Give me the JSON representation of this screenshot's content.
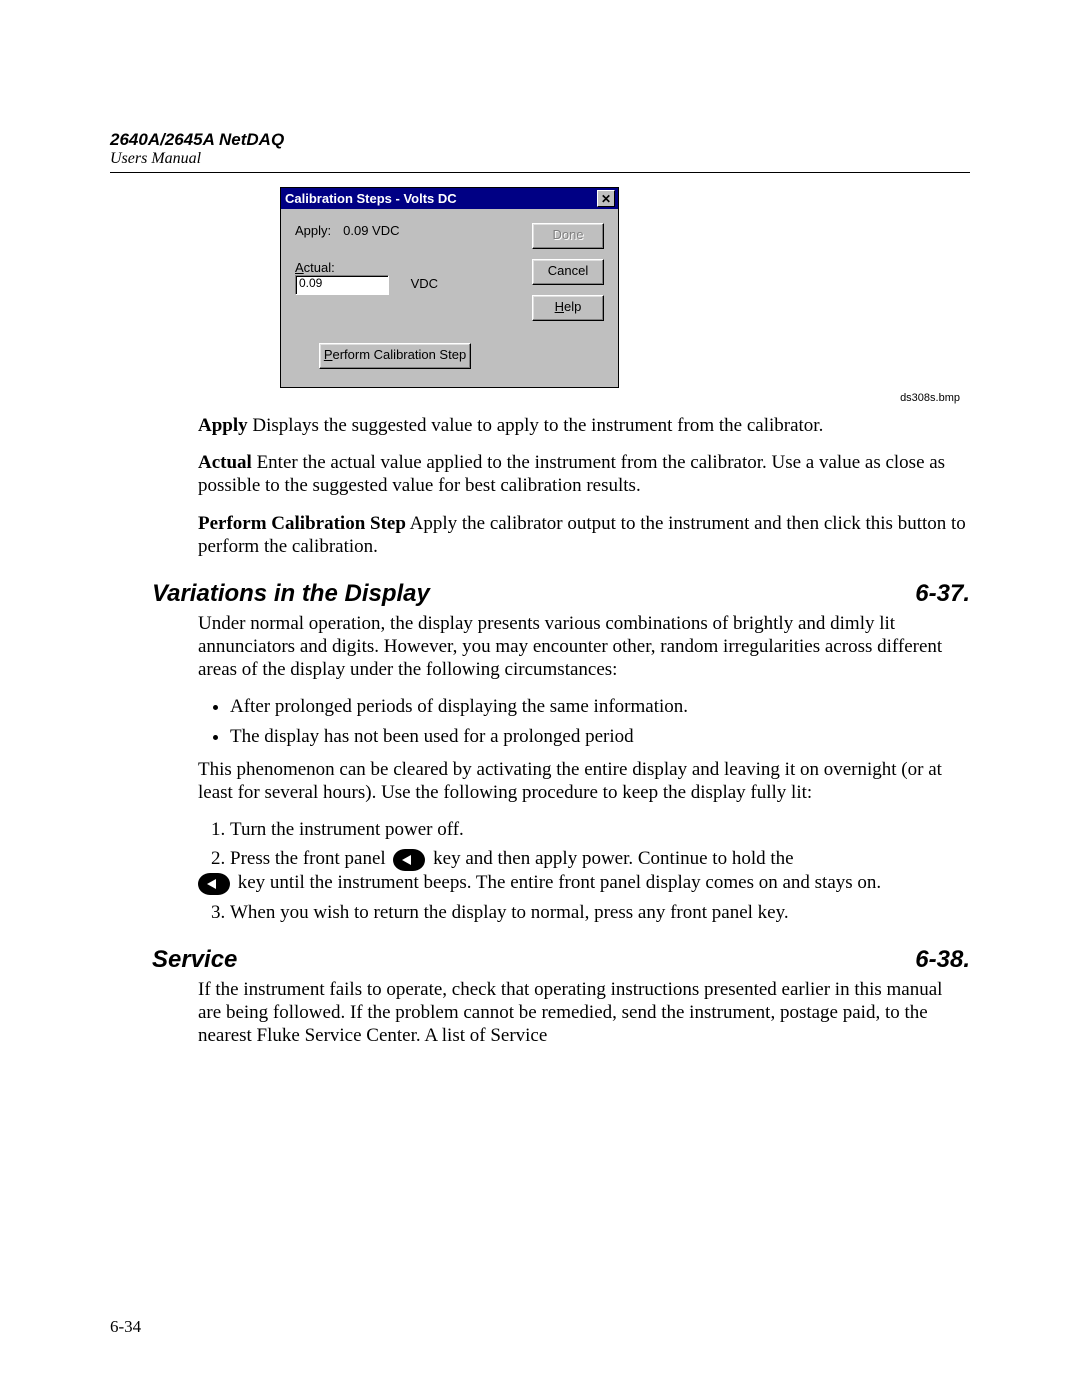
{
  "header": {
    "model": "2640A/2645A NetDAQ",
    "sub": "Users Manual"
  },
  "dialog": {
    "title": "Calibration Steps - Volts DC",
    "applyLabel": "Apply:",
    "applyValue": "0.09 VDC",
    "actualLabel": "Actual:",
    "actualValue": "0.09",
    "actualUnit": "VDC",
    "buttons": {
      "done": "Done",
      "cancel": "Cancel",
      "help": "Help",
      "perform": "Perform Calibration Step"
    }
  },
  "caption": "ds308s.bmp",
  "defs": {
    "apply": {
      "term": "Apply",
      "text": " Displays the suggested value to apply to the instrument from the calibrator."
    },
    "actual": {
      "term": "Actual",
      "text": " Enter the actual value applied to the instrument from the calibrator. Use a value as close as possible to the suggested value for best calibration results."
    },
    "perform": {
      "term": "Perform Calibration Step",
      "text": " Apply the calibrator output to the instrument and then click this button to perform the calibration."
    }
  },
  "sec1": {
    "title": "Variations in the Display",
    "num": "6-37.",
    "intro": "Under normal operation, the display presents various combinations of brightly and dimly lit annunciators and digits. However, you may encounter other, random irregularities across different areas of the display under the following circumstances:",
    "bullets": [
      "After prolonged periods of displaying the same information.",
      "The display has not been used for a prolonged period"
    ],
    "para2": "This phenomenon can be cleared by activating the entire display and leaving it on overnight (or at least for several hours). Use the following procedure to keep the display fully lit:",
    "steps": {
      "s1": "Turn the instrument power off.",
      "s2a": "Press the front panel ",
      "s2b": " key and then apply power. Continue to hold the ",
      "s2c": " key until the instrument beeps. The entire front panel display comes on and stays on.",
      "s3": "When you wish to return the display to normal, press any front panel key."
    }
  },
  "sec2": {
    "title": "Service",
    "num": "6-38.",
    "text": "If the instrument fails to operate, check that operating instructions presented earlier in this manual are being followed. If the problem cannot be remedied, send the instrument, postage paid, to the nearest Fluke Service Center. A list of Service"
  },
  "pageNumber": "6-34"
}
